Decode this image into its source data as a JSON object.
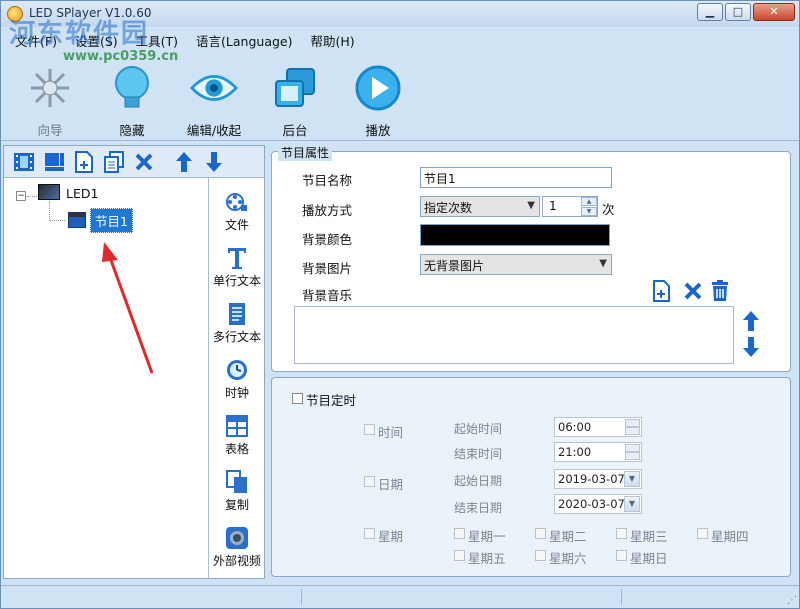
{
  "window": {
    "title": "LED SPlayer V1.0.60",
    "minimize": "▁",
    "maximize": "□",
    "close": "✕"
  },
  "watermark": {
    "text": "河东软件园",
    "url": "www.pc0359.cn"
  },
  "menu": [
    "文件(F)",
    "设置(S)",
    "工具(T)",
    "语言(Language)",
    "帮助(H)"
  ],
  "toolbar": [
    {
      "label": "向导",
      "icon": "wand-icon"
    },
    {
      "label": "隐藏",
      "icon": "bulb-icon"
    },
    {
      "label": "编辑/收起",
      "icon": "eye-icon"
    },
    {
      "label": "后台",
      "icon": "windows-icon"
    },
    {
      "label": "播放",
      "icon": "play-icon"
    }
  ],
  "tree": {
    "root": "LED1",
    "child": "节目1",
    "expander": "−"
  },
  "media": [
    {
      "label": "文件",
      "icon": "film-reel-icon"
    },
    {
      "label": "单行文本",
      "icon": "text-t-icon"
    },
    {
      "label": "多行文本",
      "icon": "document-icon"
    },
    {
      "label": "时钟",
      "icon": "clock-icon"
    },
    {
      "label": "表格",
      "icon": "table-icon"
    },
    {
      "label": "复制",
      "icon": "copy-icon"
    },
    {
      "label": "外部视频",
      "icon": "camera-icon"
    }
  ],
  "program_props": {
    "group_title": "节目属性",
    "name_label": "节目名称",
    "name_value": "节目1",
    "play_mode_label": "播放方式",
    "play_mode_value": "指定次数",
    "play_count": "1",
    "times_unit": "次",
    "bg_color_label": "背景颜色",
    "bg_image_label": "背景图片",
    "bg_image_value": "无背景图片",
    "bg_music_label": "背景音乐"
  },
  "schedule": {
    "enable_label": "节目定时",
    "time_label": "时间",
    "start_time_label": "起始时间",
    "start_time": "06:00",
    "end_time_label": "结束时间",
    "end_time": "21:00",
    "date_label": "日期",
    "start_date_label": "起始日期",
    "start_date": "2019-03-07",
    "end_date_label": "结束日期",
    "end_date": "2020-03-07",
    "week_label": "星期",
    "days": [
      "星期一",
      "星期二",
      "星期三",
      "星期四",
      "星期五",
      "星期六",
      "星期日"
    ]
  }
}
